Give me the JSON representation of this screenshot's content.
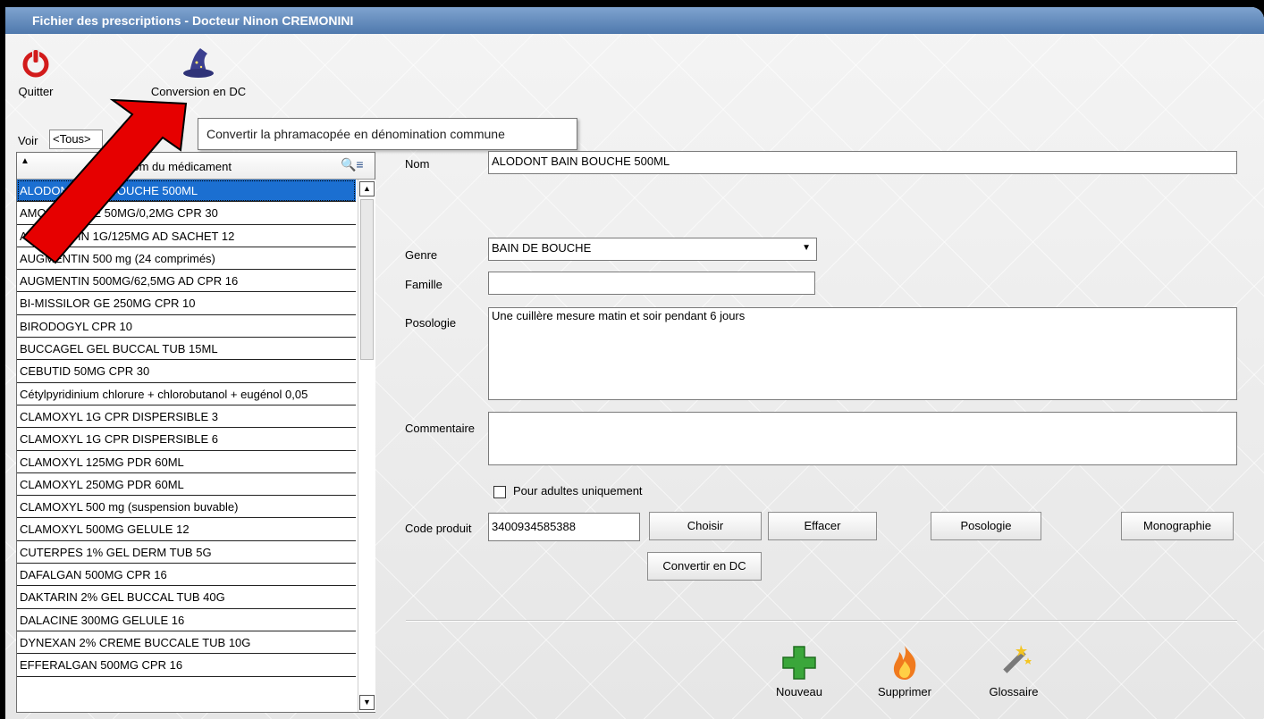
{
  "window": {
    "title": "Fichier des prescriptions - Docteur Ninon CREMONINI"
  },
  "toolbar": {
    "quit_label": "Quitter",
    "convert_label": "Conversion en DC",
    "tooltip": "Convertir la phramacopée en dénomination commune"
  },
  "filter": {
    "label": "Voir",
    "value": "<Tous>"
  },
  "list": {
    "header": "Nom du médicament",
    "items": [
      "ALODONT BAIN BOUCHE 500ML",
      "AMOXICILLINE 50MG/0,2MG CPR 30",
      "AUGMENTIN 1G/125MG AD SACHET 12",
      "AUGMENTIN 500 mg (24 comprimés)",
      "AUGMENTIN 500MG/62,5MG AD CPR 16",
      "BI-MISSILOR GE 250MG CPR 10",
      "BIRODOGYL CPR 10",
      "BUCCAGEL GEL BUCCAL TUB 15ML",
      "CEBUTID 50MG CPR 30",
      "Cétylpyridinium chlorure + chlorobutanol + eugénol 0,05",
      "CLAMOXYL 1G CPR DISPERSIBLE 3",
      "CLAMOXYL 1G CPR DISPERSIBLE 6",
      "CLAMOXYL 125MG PDR 60ML",
      "CLAMOXYL 250MG PDR 60ML",
      "CLAMOXYL 500 mg (suspension buvable)",
      "CLAMOXYL 500MG GELULE 12",
      "CUTERPES 1% GEL DERM TUB 5G",
      "DAFALGAN 500MG CPR 16",
      "DAKTARIN 2% GEL BUCCAL TUB 40G",
      "DALACINE 300MG GELULE 16",
      "DYNEXAN 2% CREME BUCCALE TUB 10G",
      "EFFERALGAN 500MG CPR 16"
    ]
  },
  "form": {
    "nom_label": "Nom",
    "nom_value": "ALODONT BAIN BOUCHE 500ML",
    "genre_label": "Genre",
    "genre_value": "BAIN DE BOUCHE",
    "famille_label": "Famille",
    "famille_value": "",
    "posologie_label": "Posologie",
    "posologie_value": "Une cuillère mesure matin et soir pendant 6 jours",
    "commentaire_label": "Commentaire",
    "commentaire_value": "",
    "adults_label": "Pour adultes uniquement",
    "code_label": "Code produit",
    "code_value": "3400934585388"
  },
  "buttons": {
    "choisir": "Choisir",
    "effacer": "Effacer",
    "posologie": "Posologie",
    "monographie": "Monographie",
    "convertir": "Convertir en DC"
  },
  "actions": {
    "nouveau": "Nouveau",
    "supprimer": "Supprimer",
    "glossaire": "Glossaire"
  },
  "colors": {
    "titlebar": "#4f79ad",
    "selection": "#1b6fd1",
    "arrow": "#e60000",
    "nouveau_icon": "#3aa63a"
  }
}
